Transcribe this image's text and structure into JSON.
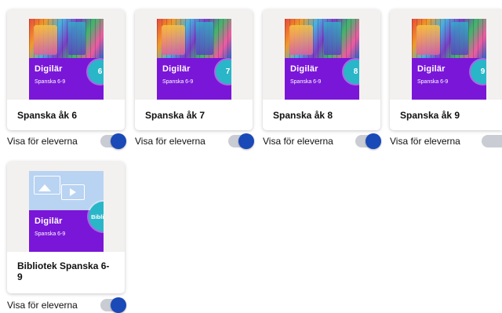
{
  "colors": {
    "brand_purple": "#7a16d8",
    "badge_teal": "#29b6c8",
    "toggle_knob": "#1a49b8",
    "toggle_track": "#c9ccd3",
    "card_top_bg": "#f3f1ef"
  },
  "cards": [
    {
      "title": "Spanska åk 6",
      "brand": "Digilär",
      "subtitle": "Spanska 6-9",
      "badge": "6",
      "show_label": "Visa för eleverna",
      "show_enabled": true
    },
    {
      "title": "Spanska åk 7",
      "brand": "Digilär",
      "subtitle": "Spanska 6-9",
      "badge": "7",
      "show_label": "Visa för eleverna",
      "show_enabled": true
    },
    {
      "title": "Spanska åk 8",
      "brand": "Digilär",
      "subtitle": "Spanska 6-9",
      "badge": "8",
      "show_label": "Visa för eleverna",
      "show_enabled": true
    },
    {
      "title": "Spanska åk 9",
      "brand": "Digilär",
      "subtitle": "Spanska 6-9",
      "badge": "9",
      "show_label": "Visa för eleverna",
      "show_enabled": true
    },
    {
      "title": "Bibliotek Spanska 6-9",
      "brand": "Digilär",
      "subtitle": "Spanska 6-9",
      "badge": "Bibliotek",
      "show_label": "Visa för eleverna",
      "show_enabled": true
    }
  ]
}
